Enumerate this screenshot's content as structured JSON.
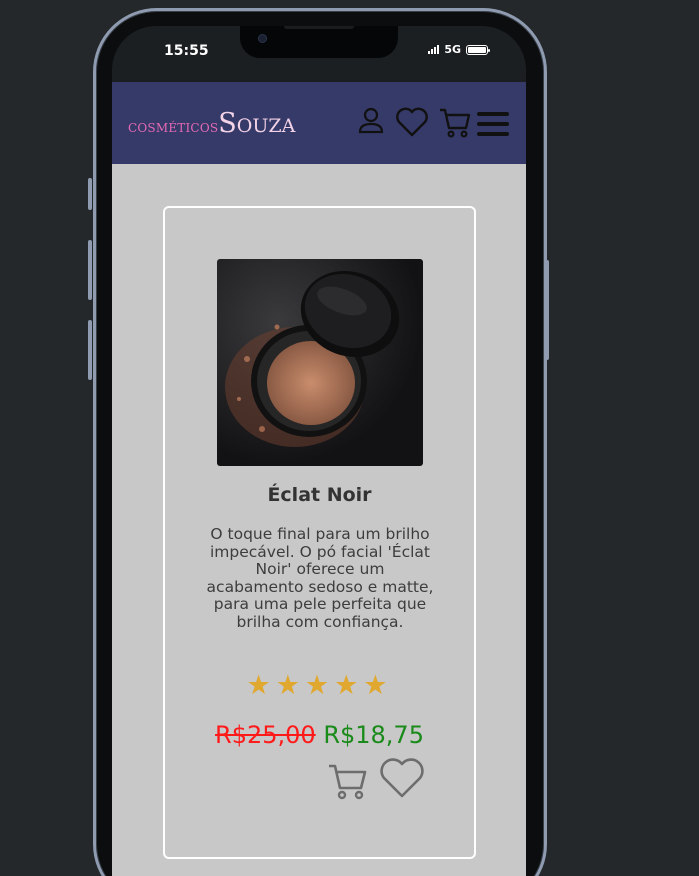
{
  "status_bar": {
    "time": "15:55",
    "network": "5G"
  },
  "header": {
    "logo_part1": "cosméticos",
    "logo_part2": "Souza",
    "icons": [
      "user-icon",
      "heart-icon",
      "cart-icon",
      "menu-icon"
    ]
  },
  "product": {
    "title": "Éclat Noir",
    "description": "O toque final para um brilho impecável. O pó facial 'Éclat Noir' oferece um acabamento sedoso e matte, para uma pele perfeita que brilha com confiança.",
    "rating": 5,
    "rating_text": "★★★★★",
    "old_price": "R$25,00",
    "new_price": "R$18,75"
  },
  "colors": {
    "header_bg": "#363a69",
    "logo_pink": "#e46ab5",
    "page_bg": "#c8c8c8",
    "star": "#e0a82e",
    "old_price": "#ff1a1a",
    "new_price": "#1a8a1a"
  }
}
